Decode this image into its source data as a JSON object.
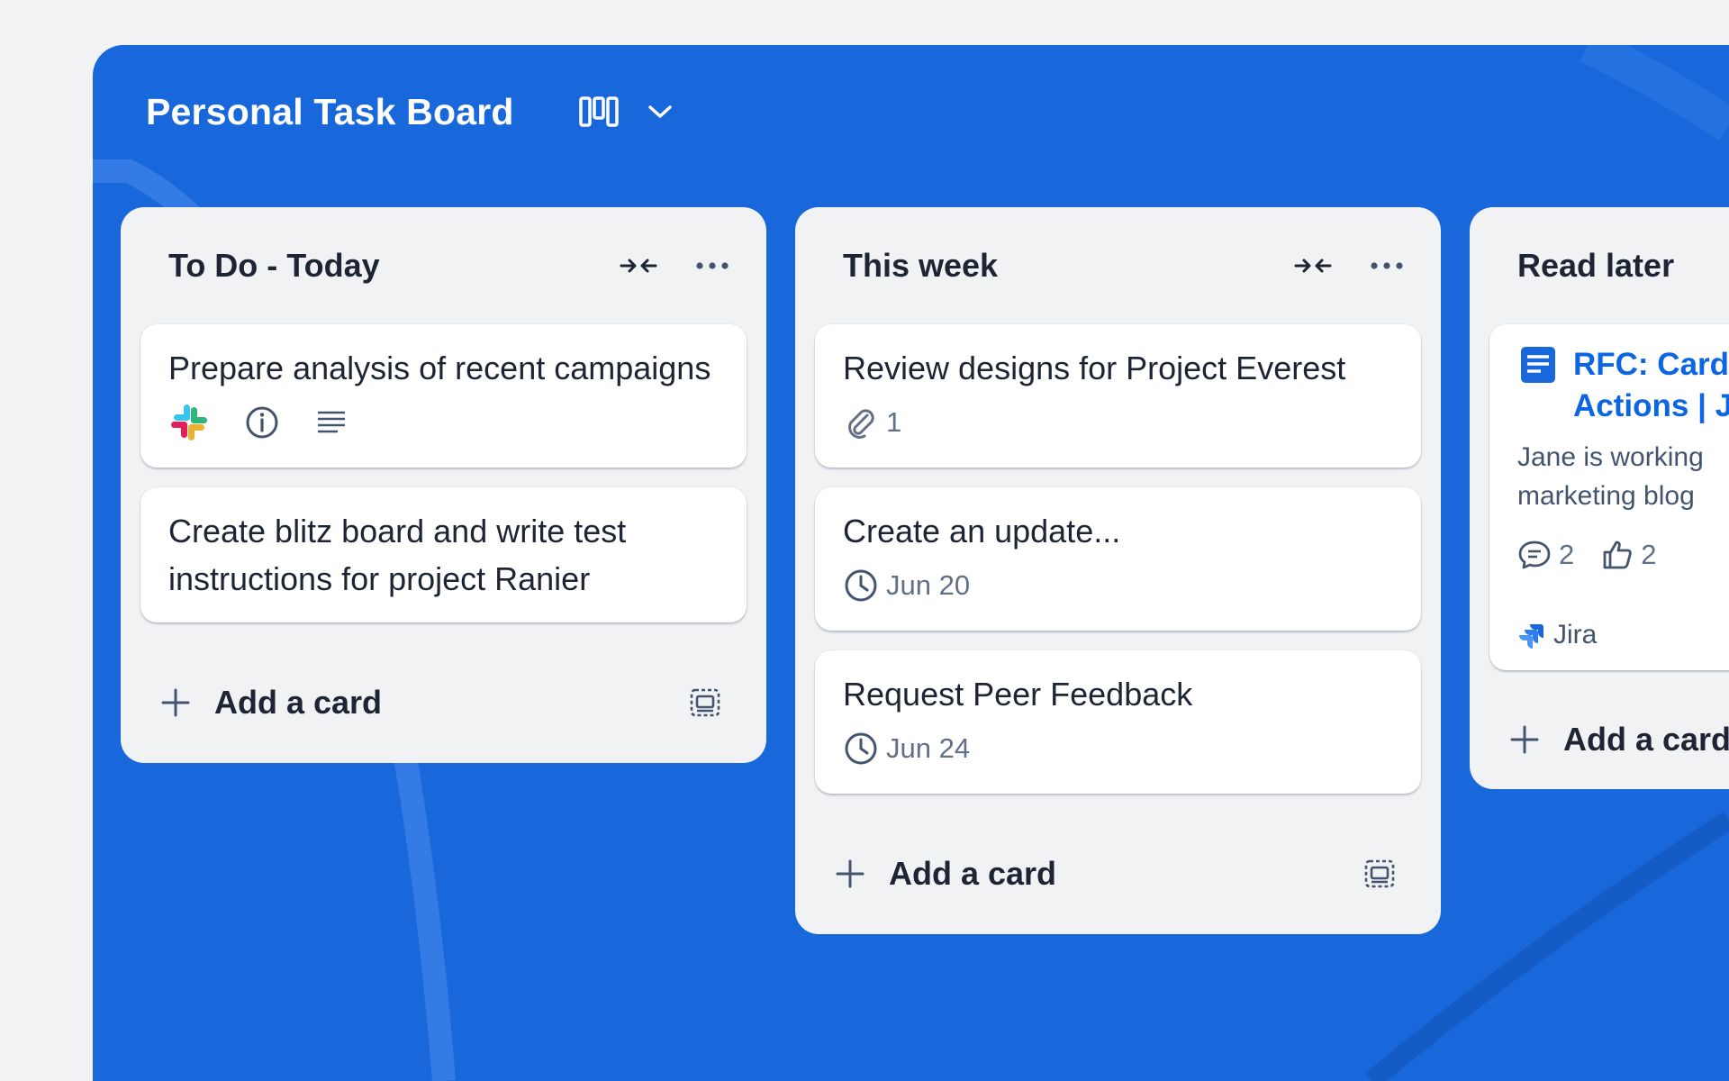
{
  "board": {
    "title": "Personal Task Board",
    "accent": "#1868db"
  },
  "lists": [
    {
      "title": "To Do - Today",
      "add_label": "Add a card",
      "cards": [
        {
          "title": "Prepare analysis of recent campaigns",
          "badges": [
            "slack-icon",
            "info-icon",
            "description-icon"
          ]
        },
        {
          "title": "Create blitz board and write test instructions for project Ranier",
          "badges": []
        }
      ]
    },
    {
      "title": "This week",
      "add_label": "Add a card",
      "cards": [
        {
          "title": "Review designs for Project Everest",
          "attachments": "1"
        },
        {
          "title": "Create an update...",
          "due": "Jun 20"
        },
        {
          "title": "Request Peer Feedback",
          "due": "Jun 24"
        }
      ]
    },
    {
      "title": "Read later",
      "add_label": "Add a card",
      "cards": [
        {
          "link_title_line1": "RFC: Card",
          "link_title_line2": "Actions | J",
          "description_line1": "Jane is working",
          "description_line2": "marketing blog",
          "comments": "2",
          "likes": "2",
          "source": "Jira"
        }
      ]
    }
  ]
}
